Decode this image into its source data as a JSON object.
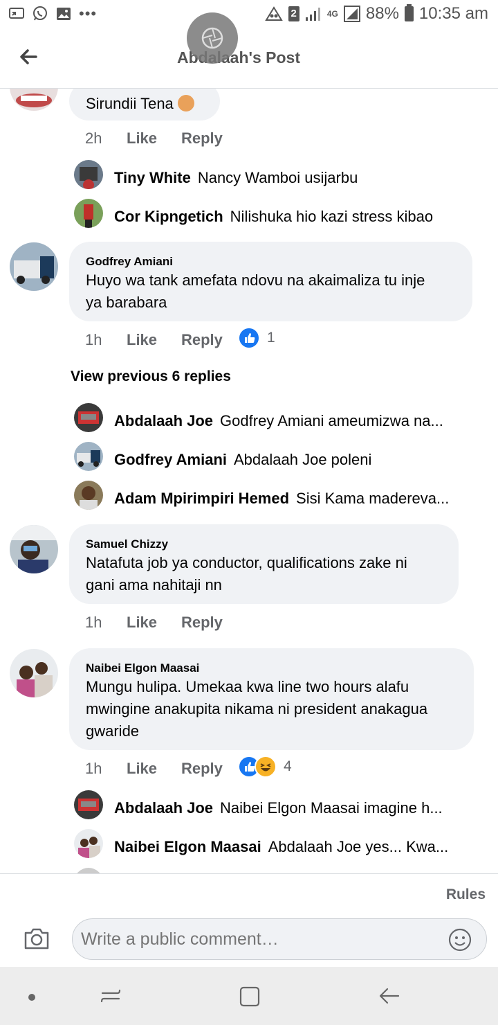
{
  "status_bar": {
    "left_icons": [
      "screen-mirror-icon",
      "whatsapp-icon",
      "gallery-icon",
      "more-dots-icon"
    ],
    "dots": "•••",
    "sim_badge": "2",
    "network": "4G",
    "battery": "88%",
    "time": "10:35 am"
  },
  "header": {
    "title": "Abdalaah's Post"
  },
  "partial_comment": {
    "text": "Sirundii Tena",
    "time": "2h",
    "like": "Like",
    "reply": "Reply"
  },
  "partial_replies": [
    {
      "name": "Tiny White",
      "text": "Nancy Wamboi usijarbu"
    },
    {
      "name": "Cor Kipngetich",
      "text": "Nilishuka  hio kazi stress kibao"
    }
  ],
  "comments": [
    {
      "name": "Godfrey Amiani",
      "lines": [
        "Huyo wa tank amefata ndovu na akaimaliza tu inje",
        "ya barabara"
      ],
      "time": "1h",
      "like": "Like",
      "reply": "Reply",
      "reactions": [
        "like"
      ],
      "reaction_count": "1",
      "view_previous": "View previous 6 replies",
      "replies": [
        {
          "name": "Abdalaah Joe",
          "text": "Godfrey Amiani ameumizwa na..."
        },
        {
          "name": "Godfrey Amiani",
          "text": "Abdalaah Joe poleni"
        },
        {
          "name": "Adam Mpirimpiri Hemed",
          "text": "Sisi Kama madereva..."
        }
      ]
    },
    {
      "name": "Samuel Chizzy",
      "lines": [
        "Natafuta job ya conductor, qualifications zake ni",
        "gani ama nahitaji nn"
      ],
      "time": "1h",
      "like": "Like",
      "reply": "Reply"
    },
    {
      "name": "Naibei Elgon Maasai",
      "lines": [
        "Mungu hulipa. Umekaa kwa line two hours alafu",
        "mwingine anakupita nikama ni president anakagua",
        "gwaride"
      ],
      "time": "1h",
      "like": "Like",
      "reply": "Reply",
      "reactions": [
        "like",
        "haha"
      ],
      "reaction_count": "4",
      "replies": [
        {
          "name": "Abdalaah Joe",
          "text": "Naibei Elgon Maasai imagine h..."
        },
        {
          "name": "Naibei Elgon Maasai",
          "text": "Abdalaah Joe yes... Kwa..."
        }
      ]
    }
  ],
  "bottom": {
    "rules": "Rules",
    "comment_placeholder": "Write a public comment…"
  },
  "nav": [
    "dot-icon",
    "recent-apps-icon",
    "home-icon",
    "back-icon"
  ],
  "colors": {
    "bubble": "#f0f2f5",
    "meta": "#65676b",
    "like_blue": "#1877f2",
    "haha_yellow": "#f7b125"
  }
}
